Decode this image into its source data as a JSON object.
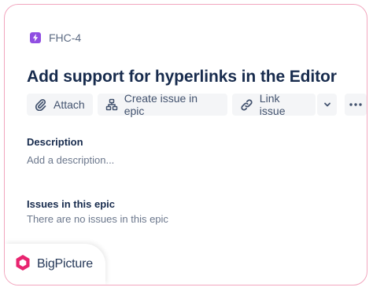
{
  "issue": {
    "key": "FHC-4",
    "title": "Add support for hyperlinks in the Editor"
  },
  "toolbar": {
    "attach_label": "Attach",
    "create_issue_label": "Create issue in epic",
    "link_issue_label": "Link issue"
  },
  "description": {
    "heading": "Description",
    "placeholder": "Add a description..."
  },
  "epic_issues": {
    "heading": "Issues in this epic",
    "empty_text": "There are no issues in this epic"
  },
  "brand": {
    "name": "BigPicture"
  },
  "colors": {
    "card_border": "#f2a6be",
    "epic_icon": "#904ee2",
    "brand_logo": "#e8246f",
    "button_bg": "#f4f5f7",
    "title_text": "#172b4d"
  },
  "icons": {
    "epic": "lightning-icon",
    "attach": "paperclip-icon",
    "create_issue": "hierarchy-icon",
    "link_issue": "link-icon",
    "dropdown": "chevron-down-icon",
    "more": "more-dots-icon",
    "brand": "bigpicture-logo-icon"
  }
}
